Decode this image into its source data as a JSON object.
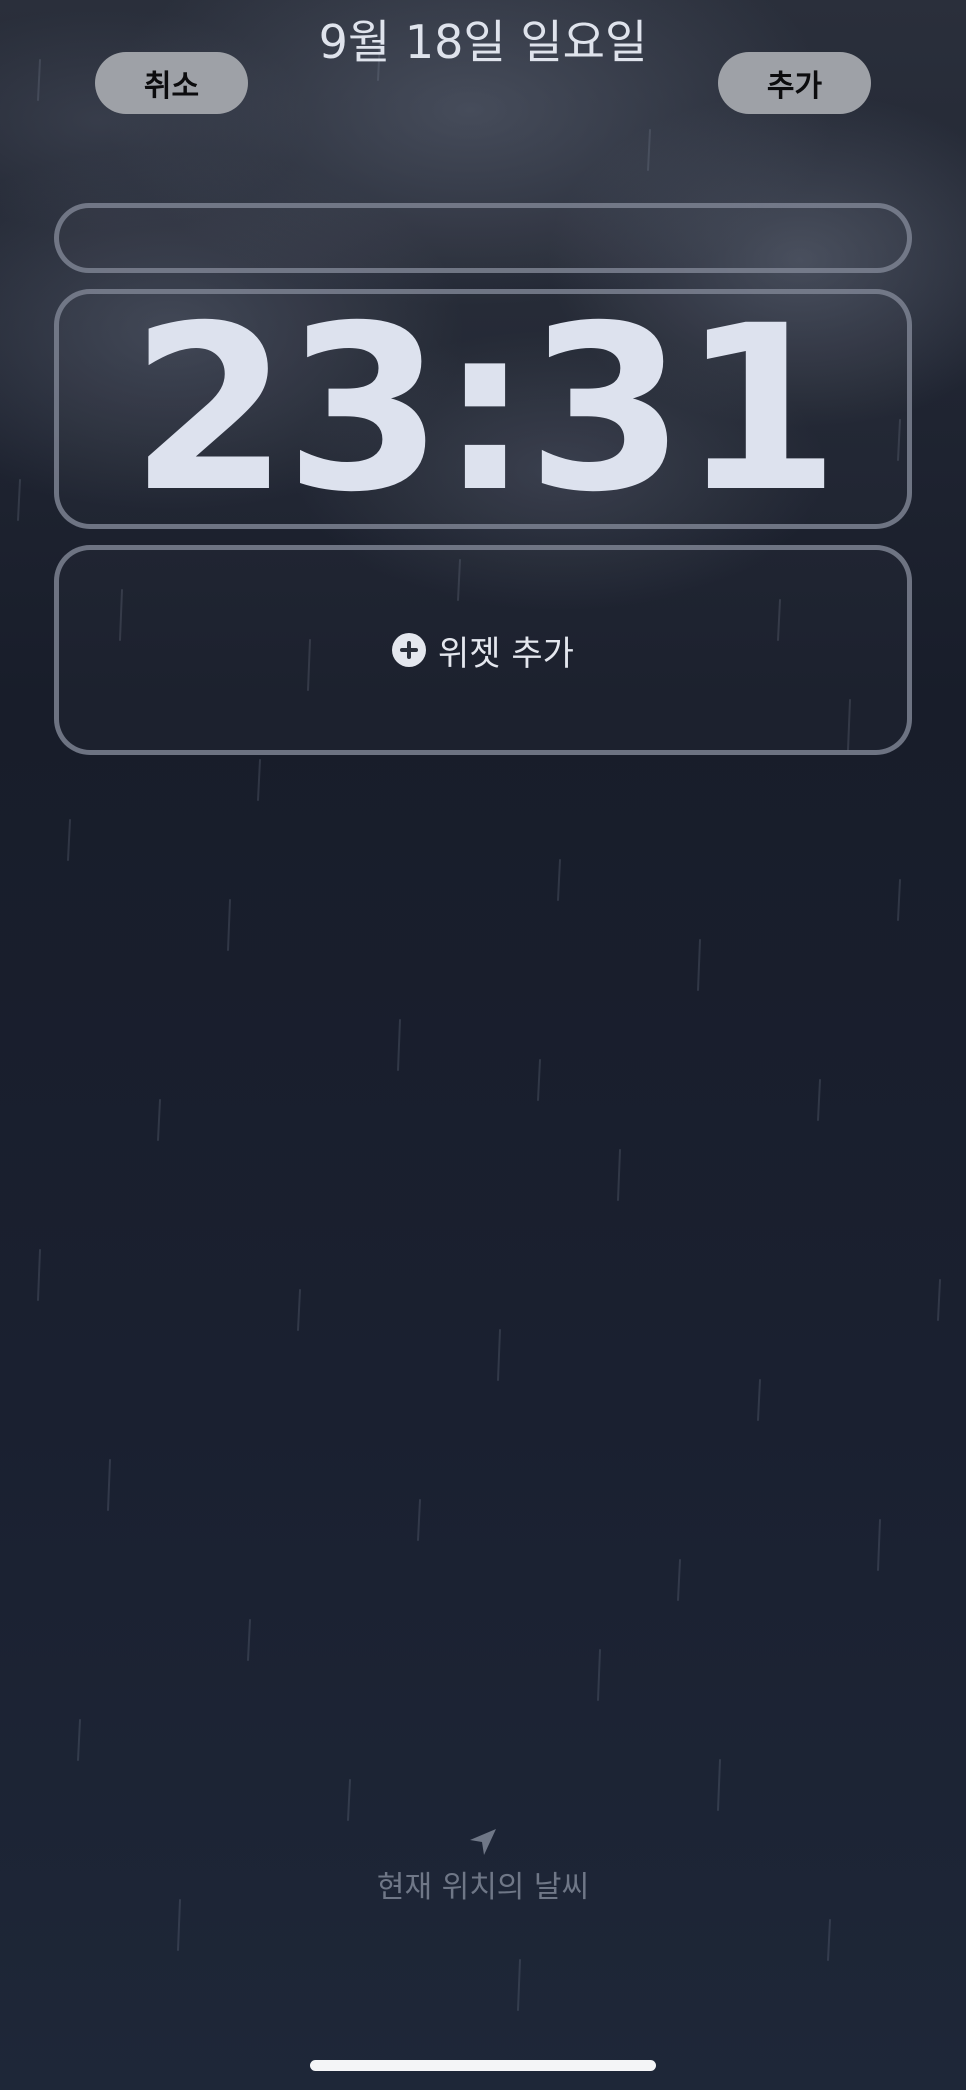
{
  "header": {
    "cancel_label": "취소",
    "add_label": "추가"
  },
  "lockscreen": {
    "date": "9월 18일 일요일",
    "time": "23:31",
    "widget_add_label": "위젯 추가"
  },
  "weather": {
    "location_label": "현재 위치의 날씨",
    "icon": "location-arrow-icon"
  },
  "colors": {
    "background": "#1c2231",
    "button_bg": "#9ea1a7",
    "frame_border": "#7d8392",
    "clock_text": "#dde2ee"
  }
}
